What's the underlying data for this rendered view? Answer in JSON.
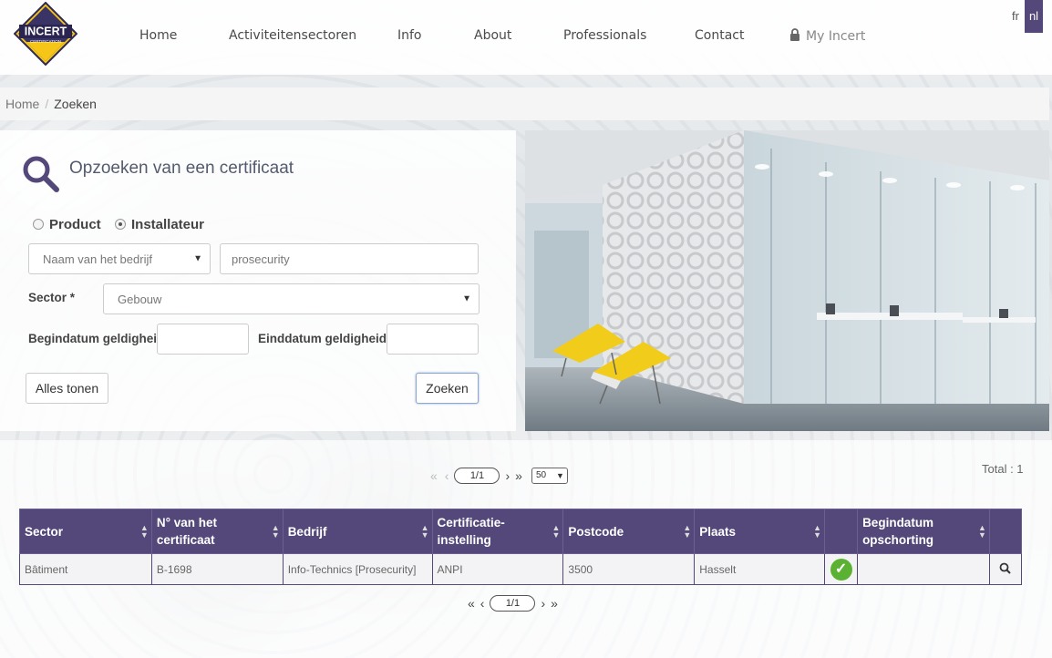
{
  "brand": {
    "logo_text": "INCERT",
    "logo_sub": "CERTIFICATION"
  },
  "nav": {
    "home": "Home",
    "sectors": "Activiteitensectoren",
    "info": "Info",
    "about": "About",
    "professionals": "Professionals",
    "contact": "Contact",
    "my_incert": "My Incert",
    "lang_fr": "fr",
    "lang_nl": "nl"
  },
  "breadcrumb": {
    "home": "Home",
    "current": "Zoeken"
  },
  "search": {
    "title": "Opzoeken van een certificaat",
    "radio_product": "Product",
    "radio_installer": "Installateur",
    "selected_radio": "Installateur",
    "field_type": "Naam van het bedrijf",
    "query": "prosecurity",
    "sector_label": "Sector *",
    "sector_value": "Gebouw",
    "start_label": "Begindatum geldigheid",
    "end_label": "Einddatum geldigheid",
    "show_all": "Alles tonen",
    "submit": "Zoeken"
  },
  "pager_top": {
    "page": "1/1",
    "per_page": "50",
    "total": "Total : 1"
  },
  "pager_bottom": {
    "page": "1/1"
  },
  "table": {
    "headers": {
      "sector": "Sector",
      "cert_no_1": "N° van het",
      "cert_no_2": "certificaat",
      "company": "Bedrijf",
      "body_1": "Certificatie-",
      "body_2": "instelling",
      "postcode": "Postcode",
      "city": "Plaats",
      "susp_1": "Begindatum",
      "susp_2": "opschorting"
    },
    "rows": [
      {
        "sector": "Bâtiment",
        "cert_no": "B-1698",
        "company": "Info-Technics [Prosecurity]",
        "body": "ANPI",
        "postcode": "3500",
        "city": "Hasselt",
        "status": "valid",
        "suspension": ""
      }
    ]
  },
  "colors": {
    "accent": "#54487a",
    "valid": "#5bb131"
  }
}
